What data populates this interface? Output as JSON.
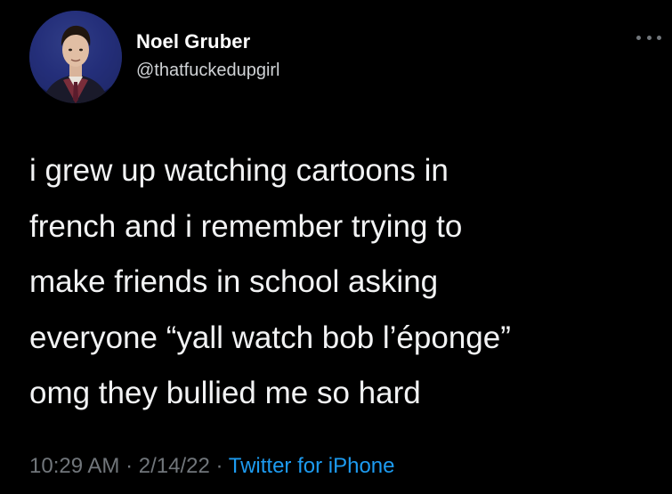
{
  "tweet": {
    "author": {
      "display_name": "Noel Gruber",
      "handle": "@thatfuckedupgirl"
    },
    "text": "i grew up watching cartoons in\nfrench and i remember trying to\nmake friends in school asking\neveryone “yall watch bob l’éponge”\nomg they bullied me so hard",
    "time": "10:29 AM",
    "separator": "·",
    "date": "2/14/22",
    "source": "Twitter for iPhone"
  },
  "icons": {
    "more": "more-options-icon"
  },
  "colors": {
    "background": "#000000",
    "text": "#e7e9ea",
    "muted": "#71767b",
    "link": "#1d9bf0"
  }
}
